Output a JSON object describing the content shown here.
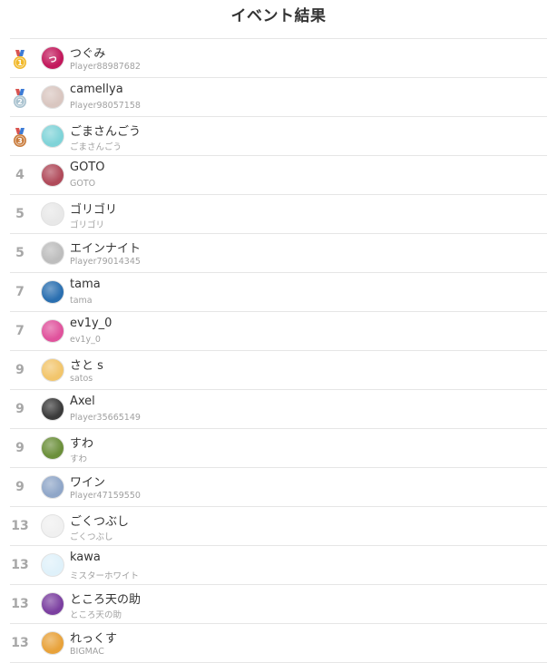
{
  "page": {
    "title": "イベント結果"
  },
  "rows": [
    {
      "rank": "",
      "medal": "gold-medal-icon",
      "medal_num": "1",
      "name": "つぐみ",
      "sub": "Player88987682",
      "avatar_icon": "avatar-tsugumi",
      "avatar_color": "#c2185b",
      "avatar_text": "っ"
    },
    {
      "rank": "",
      "medal": "silver-medal-icon",
      "medal_num": "2",
      "name": "camellya",
      "sub": "Player98057158",
      "avatar_icon": "avatar-camellya",
      "avatar_color": "#d9c6c0",
      "avatar_text": ""
    },
    {
      "rank": "",
      "medal": "bronze-medal-icon",
      "medal_num": "3",
      "name": "ごまさんごう",
      "sub": "ごまさんごう",
      "avatar_icon": "avatar-gomasangou",
      "avatar_color": "#7fd3d8",
      "avatar_text": ""
    },
    {
      "rank": "4",
      "name": "GOTO",
      "sub": "GOTO",
      "avatar_icon": "avatar-goto",
      "avatar_color": "#b04a5a",
      "avatar_text": ""
    },
    {
      "rank": "5",
      "name": "ゴリゴリ",
      "sub": "ゴリゴリ",
      "avatar_icon": "avatar-gorigori",
      "avatar_color": "#e8e8e8",
      "avatar_text": ""
    },
    {
      "rank": "5",
      "name": "エインナイト",
      "sub": "Player79014345",
      "avatar_icon": "avatar-einknight",
      "avatar_color": "#bdbdbd",
      "avatar_text": ""
    },
    {
      "rank": "7",
      "name": "tama",
      "sub": "tama",
      "avatar_icon": "avatar-tama",
      "avatar_color": "#2a6fb0",
      "avatar_text": ""
    },
    {
      "rank": "7",
      "name": "ev1y_0",
      "sub": "ev1y_0",
      "avatar_icon": "avatar-ev1y",
      "avatar_color": "#e0529c",
      "avatar_text": ""
    },
    {
      "rank": "9",
      "name": "さと s",
      "sub": "satos",
      "avatar_icon": "avatar-satos",
      "avatar_color": "#f2c56b",
      "avatar_text": ""
    },
    {
      "rank": "9",
      "name": "Axel",
      "sub": "Player35665149",
      "avatar_icon": "avatar-axel",
      "avatar_color": "#3a3a3a",
      "avatar_text": ""
    },
    {
      "rank": "9",
      "name": "すわ",
      "sub": "すわ",
      "avatar_icon": "avatar-suwa",
      "avatar_color": "#6b8f3a",
      "avatar_text": ""
    },
    {
      "rank": "9",
      "name": "ワイン",
      "sub": "Player47159550",
      "avatar_icon": "avatar-wine",
      "avatar_color": "#8fa6c8",
      "avatar_text": ""
    },
    {
      "rank": "13",
      "name": "ごくつぶし",
      "sub": "ごくつぶし",
      "avatar_icon": "avatar-gokutsubushi",
      "avatar_color": "#f0f0f0",
      "avatar_text": ""
    },
    {
      "rank": "13",
      "name": "kawa",
      "sub": "ミスターホワイト",
      "avatar_icon": "avatar-kawa",
      "avatar_color": "#dff1fa",
      "avatar_text": ""
    },
    {
      "rank": "13",
      "name": "ところ天の助",
      "sub": "ところ天の助",
      "avatar_icon": "avatar-tokoroten",
      "avatar_color": "#7b3fa0",
      "avatar_text": ""
    },
    {
      "rank": "13",
      "name": "れっくす",
      "sub": "BIGMAC",
      "avatar_icon": "avatar-rex",
      "avatar_color": "#e8a23a",
      "avatar_text": ""
    }
  ],
  "colors": {
    "gold": "#f1b92b",
    "silver": "#a9c2cf",
    "bronze": "#c97b3b",
    "rank_gray": "#a7a7a7",
    "divider": "#e6e6e6"
  }
}
